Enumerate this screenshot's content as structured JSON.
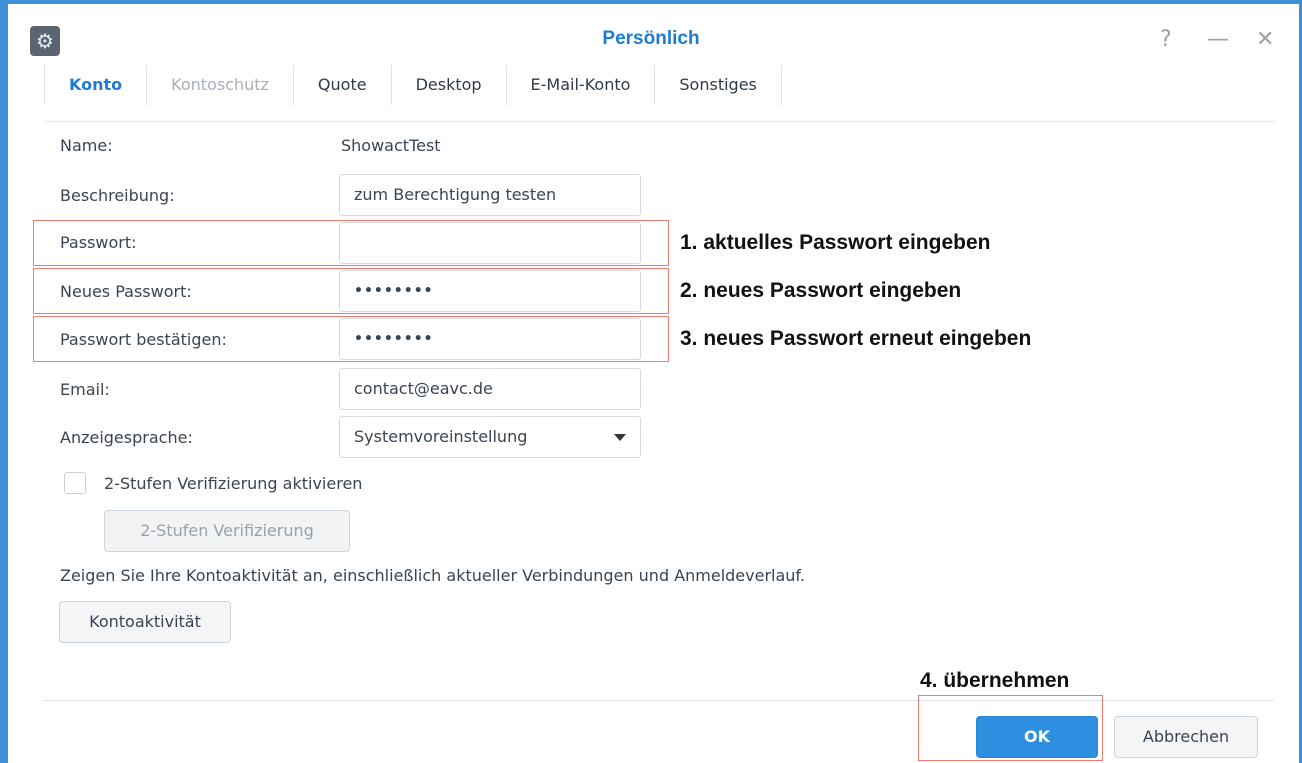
{
  "window": {
    "title": "Persönlich",
    "controls": {
      "help": "?",
      "minimize": "—",
      "close": "✕"
    }
  },
  "tabs": [
    {
      "label": "Konto",
      "state": "active"
    },
    {
      "label": "Kontoschutz",
      "state": "disabled"
    },
    {
      "label": "Quote",
      "state": "normal"
    },
    {
      "label": "Desktop",
      "state": "normal"
    },
    {
      "label": "E-Mail-Konto",
      "state": "normal"
    },
    {
      "label": "Sonstiges",
      "state": "normal"
    }
  ],
  "form": {
    "name_label": "Name:",
    "name_value": "ShowactTest",
    "description_label": "Beschreibung:",
    "description_value": "zum Berechtigung testen",
    "password_label": "Passwort:",
    "password_value": "",
    "new_password_label": "Neues Passwort:",
    "new_password_value": "••••••••",
    "confirm_password_label": "Passwort bestätigen:",
    "confirm_password_value": "••••••••",
    "email_label": "Email:",
    "email_value": "contact@eavc.de",
    "language_label": "Anzeigesprache:",
    "language_value": "Systemvoreinstellung",
    "two_step_checkbox_label": "2-Stufen Verifizierung aktivieren",
    "two_step_checkbox_checked": false,
    "two_step_button": "2-Stufen Verifizierung",
    "activity_info": "Zeigen Sie Ihre Kontoaktivität an, einschließlich aktueller Verbindungen und Anmeldeverlauf.",
    "activity_button": "Kontoaktivität"
  },
  "annotations": {
    "step1": "1. aktuelles Passwort eingeben",
    "step2": "2. neues Passwort eingeben",
    "step3": "3. neues Passwort erneut eingeben",
    "step4": "4. übernehmen",
    "highlight_color": "#ee7a73"
  },
  "footer": {
    "ok_label": "OK",
    "cancel_label": "Abbrechen"
  },
  "colors": {
    "accent": "#1f7bd4",
    "primary_button": "#2e8fe0",
    "window_frame": "#3f8fd6"
  }
}
